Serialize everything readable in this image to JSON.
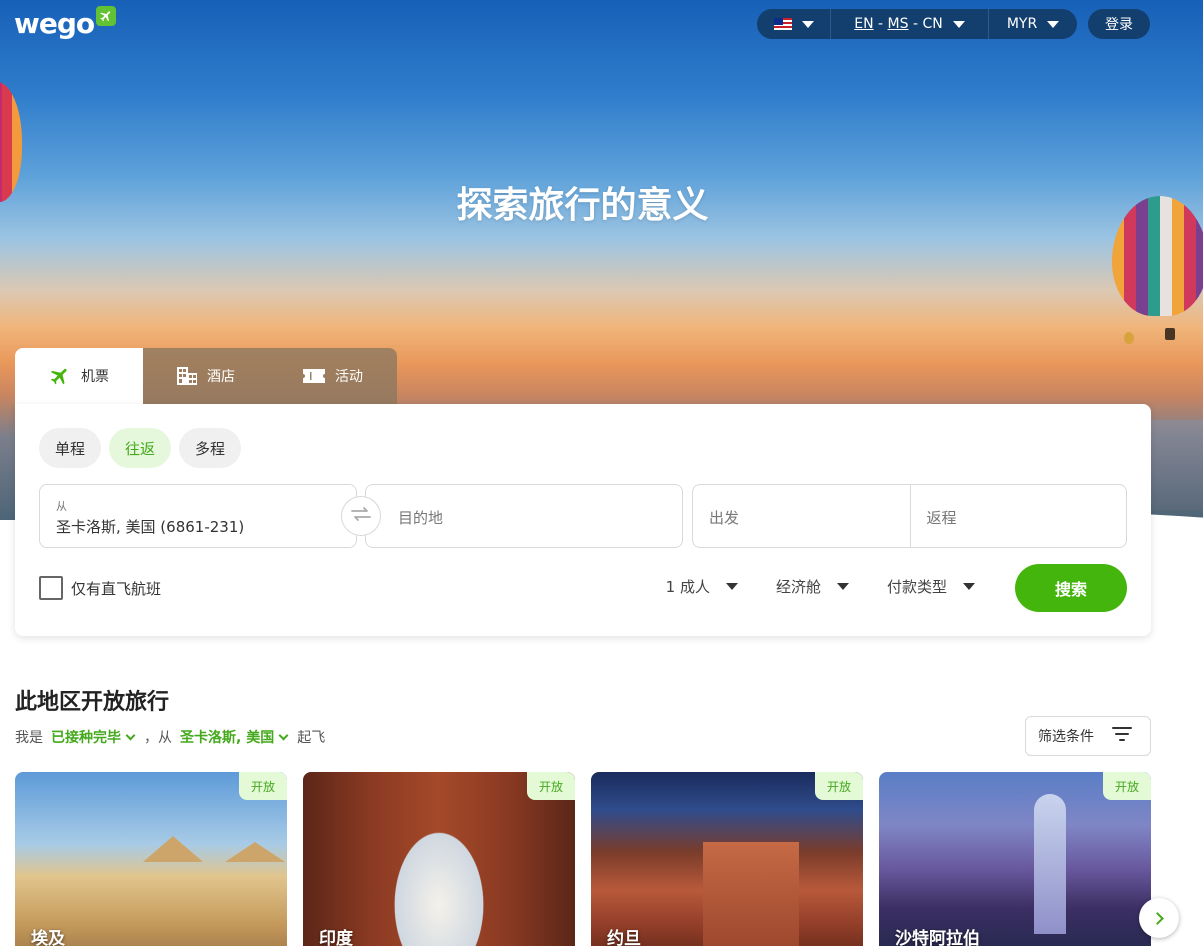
{
  "brand": {
    "logo_text": "wego",
    "accent": "#44b50c"
  },
  "header": {
    "locale_flag": "malaysia-flag-icon",
    "languages": {
      "en": "EN",
      "sep1": " - ",
      "ms": "MS",
      "sep2": " - ",
      "cn": "CN"
    },
    "currency": "MYR",
    "login": "登录"
  },
  "hero": {
    "title": "探索旅行的意义"
  },
  "search": {
    "tabs": [
      {
        "label": "机票",
        "icon": "airplane-icon"
      },
      {
        "label": "酒店",
        "icon": "hotel-icon"
      },
      {
        "label": "活动",
        "icon": "ticket-icon"
      }
    ],
    "trip_types": [
      "单程",
      "往返",
      "多程"
    ],
    "selected_trip_type": "往返",
    "from": {
      "label": "从",
      "value": "圣卡洛斯, 美国 (6861-231)"
    },
    "to": {
      "placeholder": "目的地"
    },
    "depart": {
      "placeholder": "出发"
    },
    "return": {
      "placeholder": "返程"
    },
    "direct_only": "仅有直飞航班",
    "passengers": "1 成人",
    "cabin": "经济舱",
    "payment": "付款类型",
    "submit": "搜索"
  },
  "open_travel": {
    "title": "此地区开放旅行",
    "line": {
      "prefix": "我是",
      "status": "已接种完毕",
      "comma": "，从",
      "origin": "圣卡洛斯, 美国",
      "suffix": "起飞"
    },
    "filter": "筛选条件",
    "cards": [
      {
        "name": "埃及",
        "badge": "开放"
      },
      {
        "name": "印度",
        "badge": "开放"
      },
      {
        "name": "约旦",
        "badge": "开放"
      },
      {
        "name": "沙特阿拉伯",
        "badge": "开放"
      }
    ]
  }
}
